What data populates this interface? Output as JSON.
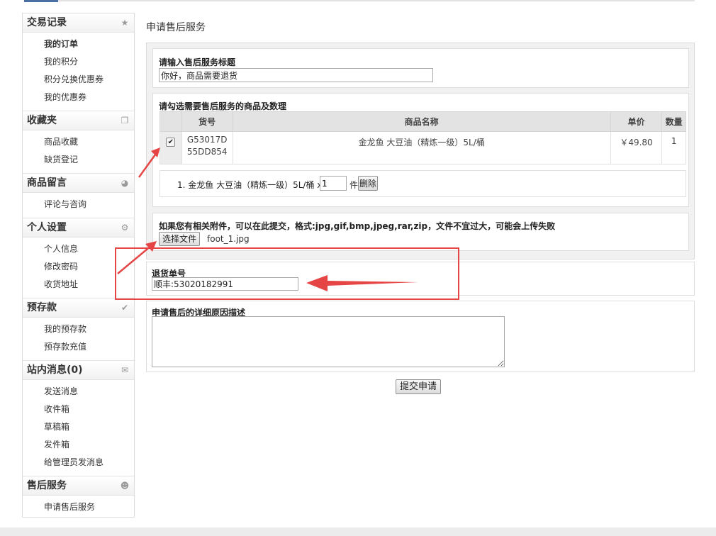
{
  "sidebar": {
    "sections": [
      {
        "title": "交易记录",
        "icon": "star-icon",
        "items": [
          "我的订单",
          "我的积分",
          "积分兑换优惠券",
          "我的优惠券"
        ]
      },
      {
        "title": "收藏夹",
        "icon": "stack-icon",
        "items": [
          "商品收藏",
          "缺货登记"
        ]
      },
      {
        "title": "商品留言",
        "icon": "chat-bubble-icon",
        "items": [
          "评论与咨询"
        ]
      },
      {
        "title": "个人设置",
        "icon": "gear-icon",
        "items": [
          "个人信息",
          "修改密码",
          "收货地址"
        ]
      },
      {
        "title": "预存款",
        "icon": "shield-check-icon",
        "items": [
          "我的预存款",
          "预存款充值"
        ]
      },
      {
        "title": "站内消息(0)",
        "icon": "envelope-icon",
        "items": [
          "发送消息",
          "收件箱",
          "草稿箱",
          "发件箱",
          "给管理员发消息"
        ]
      },
      {
        "title": "售后服务",
        "icon": "user-icon",
        "items": [
          "申请售后服务"
        ]
      }
    ]
  },
  "main": {
    "title": "申请售后服务",
    "service_title": {
      "label": "请输入售后服务标题",
      "value": "你好，商品需要退货"
    },
    "goods": {
      "label": "请勾选需要售后服务的商品及数理",
      "columns": [
        "货号",
        "商品名称",
        "单价",
        "数量"
      ],
      "rows": [
        {
          "checked": true,
          "sku": "G53017D55DD854",
          "name": "金龙鱼 大豆油（精炼一级）5L/桶",
          "price": "￥49.80",
          "qty": "1"
        }
      ],
      "cart_line": "1. 金龙鱼 大豆油（精炼一级）5L/桶 x",
      "cart_qty": "1",
      "cart_unit": "件",
      "delete_label": "删除"
    },
    "attachment": {
      "label": "如果您有相关附件，可以在此提交，格式:jpg,gif,bmp,jpeg,rar,zip，文件不宜过大，可能会上传失败",
      "choose_label": "选择文件",
      "filename": "foot_1.jpg"
    },
    "return_no": {
      "label": "退货单号",
      "value": "顺丰:53020182991"
    },
    "reason": {
      "label": "申请售后的详细原因描述",
      "value": ""
    },
    "submit_label": "提交申请"
  },
  "colors": {
    "annotation": "#e64545",
    "header_bg": "#e3e3e3"
  }
}
